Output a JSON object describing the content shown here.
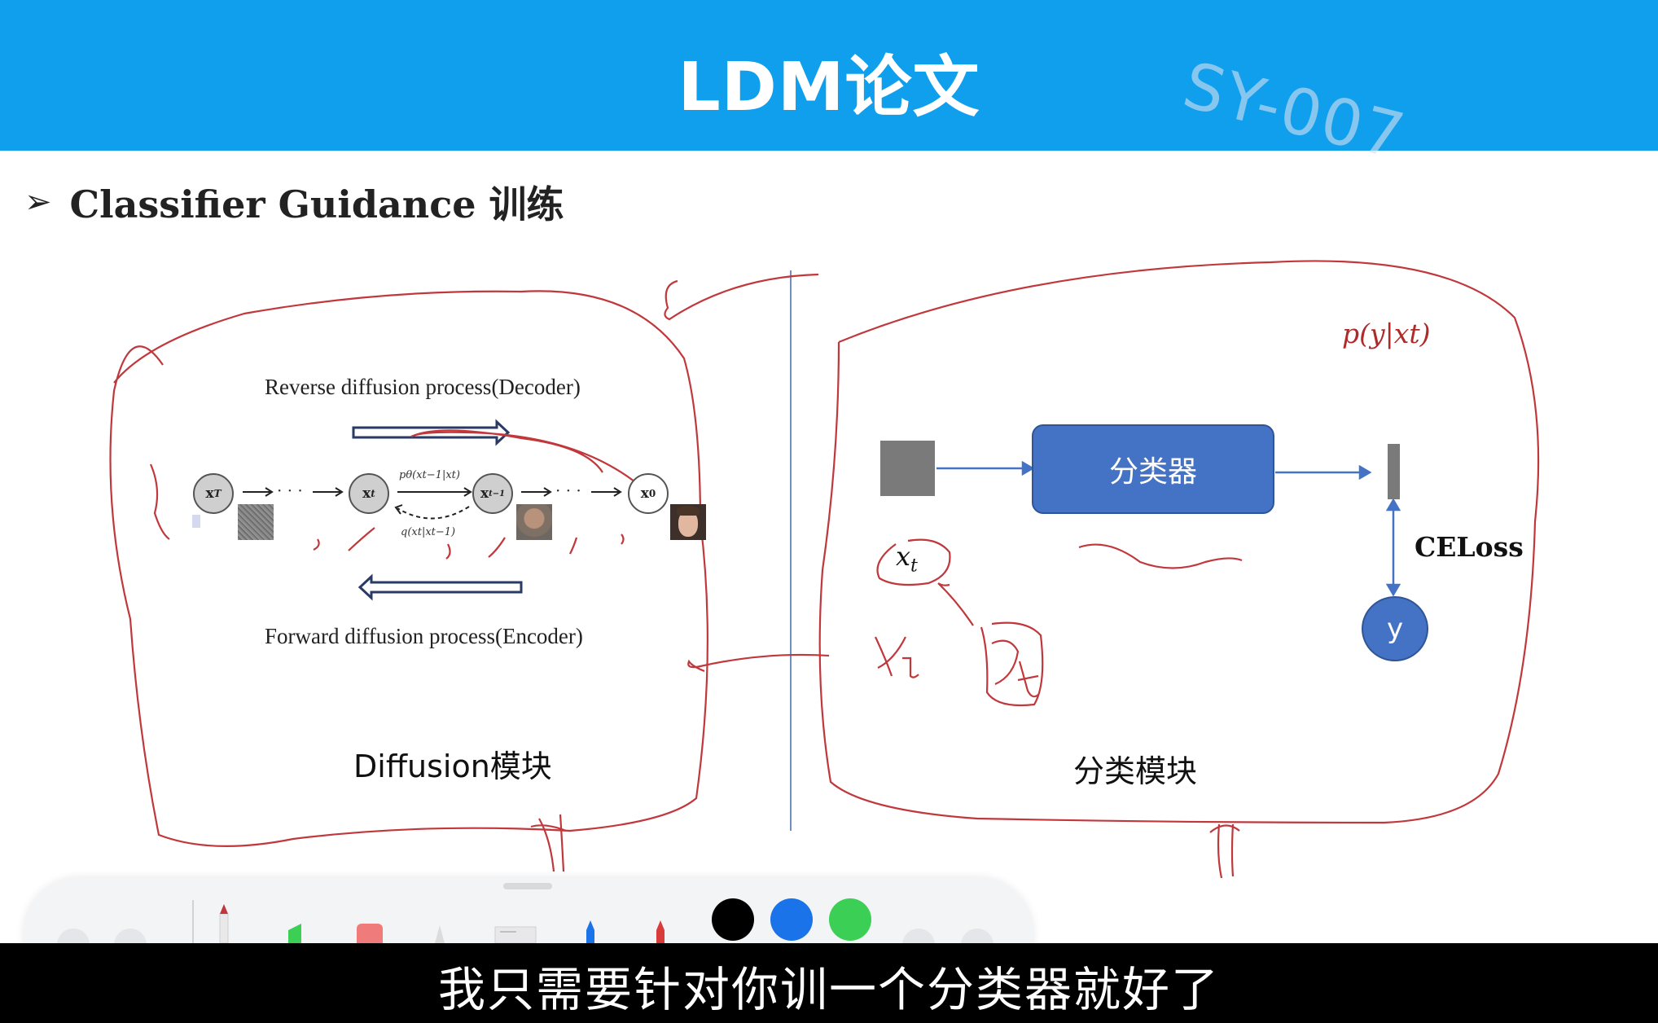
{
  "header": {
    "title": "LDM论文",
    "watermark": "SY-007",
    "bg_color": "#0f9fec"
  },
  "section": {
    "bullet": "➢",
    "heading": "Classifier Guidance 训练"
  },
  "diffusion": {
    "caption_top": "Reverse diffusion process(Decoder)",
    "caption_bottom": "Forward diffusion process(Encoder)",
    "nodes": {
      "xT_main": "x",
      "xT_sub": "T",
      "xt_main": "x",
      "xt_sub": "t",
      "xt1_main": "x",
      "xt1_sub": "t−1",
      "x0_main": "x",
      "x0_sub": "0"
    },
    "dots": "→ · · · →",
    "p_label": "pθ(xt−1|xt)",
    "q_label": "q(xt|xt−1)",
    "module_label": "Diffusion模块"
  },
  "classifier": {
    "box_label": "分类器",
    "loss_label": "CELoss",
    "y_label": "y",
    "module_label": "分类模块",
    "annotation_prob": "p(y|xt)",
    "annotation_xt": "x",
    "annotation_xt_sub": "t",
    "box_color": "#4472c4"
  },
  "toolbar": {
    "colors": [
      "#000000",
      "#1a73e8",
      "#3ccf55"
    ]
  },
  "subtitle": {
    "text": "我只需要针对你训一个分类器就好了"
  }
}
